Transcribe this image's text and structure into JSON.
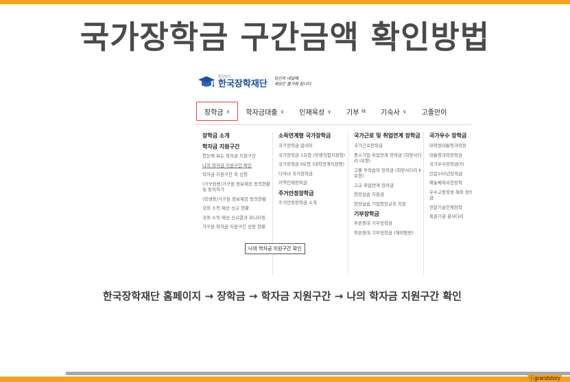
{
  "slide": {
    "title": "국가장학금 구간금액  확인방법",
    "caption": "한국장학재단 홈페이지 → 장학금 → 학자금 지원구간 → 나의 학자금 지원구간 확인",
    "copyright": "ⓒgrandstory",
    "accent_color": "#f7a21b"
  },
  "site": {
    "logo_sub": "통합링크",
    "logo_name": "한국장학재단",
    "logo_slogan_1": "당신의 내일에,",
    "logo_slogan_2": "세상은 즐거워 집니다",
    "brand_color": "#1e4fa0",
    "nav": [
      {
        "label": "장학금",
        "chev": "∧"
      },
      {
        "label": "학자금대출",
        "chev": "∨"
      },
      {
        "label": "인재육성",
        "chev": "∨"
      },
      {
        "label": "기부",
        "chev": "⧉"
      },
      {
        "label": "기숙사",
        "chev": "∨"
      },
      {
        "label": "고졸만이",
        "chev": ""
      }
    ],
    "tooltip": "나의 학자금 지원구간 확인",
    "col1": {
      "head": "장학금 소개",
      "sub": "학자금 지원구간",
      "items": [
        "한눈에 보는 학자금 지원구간",
        "나의 학자금 지원구간 확인",
        "학자금 지원구간 최 신청",
        "(가구원용)가구원 정보제공 동의현황 및 동의하기",
        "(학생용)가구원 정보제공 동의현황",
        "국외 소득·재산 신고 현황",
        "국외 소득·재산 신고결과 모니터링",
        "가구원 학자금 지원구간 산정 현황"
      ]
    },
    "col2": {
      "head": "소득연계형 국가장학금",
      "items": [
        "국가장학금 알리미",
        "국가장학금 1유형 (학생직접지원형)",
        "국가장학금 Ⅱ유형 (대학연계지원형)",
        "다자녀 국가장학금",
        "지역인재장학금"
      ],
      "sub": "주거안정장학금",
      "sub_items": [
        "주거안정장학금 소개"
      ]
    },
    "col3": {
      "head": "국가근로 및 취업연계 장학금",
      "items": [
        "국가근로장학금",
        "중소기업 취업연계 장학금 (희망사다리 Ⅰ유형)",
        "고졸 후학습자 장학금 (희망사다리 Ⅱ유형)",
        "고교 취업연계 장려금",
        "현장실습 지원금",
        "현장실습 기업현장교육 지원"
      ],
      "sub": "기부장학금",
      "sub_items": [
        "푸른등대 기부장학금",
        "푸른등대 기부장학금 (해외탐방)"
      ]
    },
    "col4": {
      "head": "국가우수 장학금",
      "items": [
        "대학원대통령과학장",
        "대통령과학장학금",
        "국가우수장학금(이",
        "인문100년장학금",
        "예술체육비전장학",
        "우수고등학생 해외 장학금(드림장학금",
        "전문기술인재장학",
        "복권기금 꿈사다리"
      ]
    }
  }
}
